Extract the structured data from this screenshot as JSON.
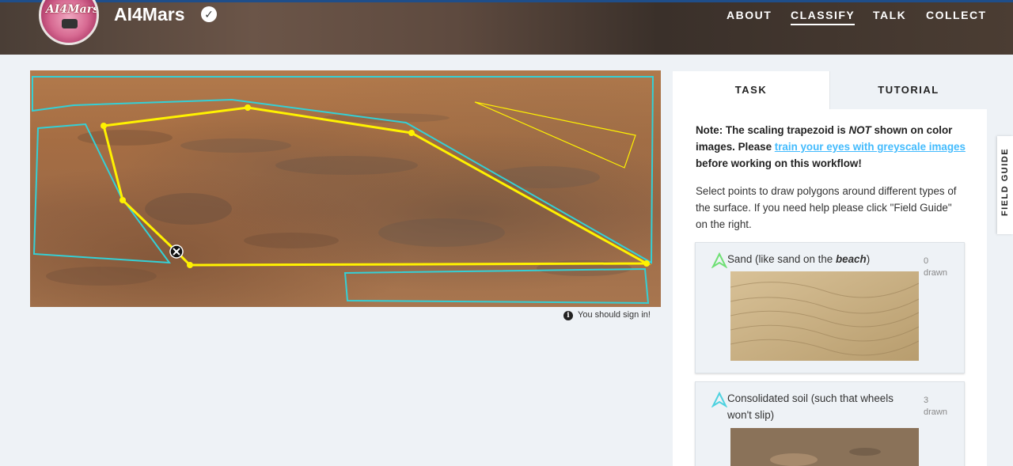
{
  "header": {
    "logo_text": "AI4Mars",
    "title": "AI4Mars",
    "nav": [
      {
        "label": "ABOUT",
        "active": false
      },
      {
        "label": "CLASSIFY",
        "active": true
      },
      {
        "label": "TALK",
        "active": false
      },
      {
        "label": "COLLECT",
        "active": false
      }
    ]
  },
  "canvas": {
    "sign_in_note": "You should sign in!"
  },
  "panel": {
    "tabs": [
      "TASK",
      "TUTORIAL"
    ],
    "note_prefix": "Note: The scaling trapezoid is ",
    "note_emph": "NOT",
    "note_mid": " shown on color images. Please ",
    "note_link": "train your eyes with greyscale images",
    "note_suffix": " before working on this workflow!",
    "instructions": "Select points to draw polygons around different types of the surface. If you need help please click \"Field Guide\" on the right.",
    "choices": [
      {
        "label_pre": "Sand (like sand on the ",
        "label_emph": "beach",
        "label_post": ")",
        "count": "0",
        "drawn": "drawn",
        "color": "#6fdf75"
      },
      {
        "label_pre": "Consolidated soil (such that wheels won't slip)",
        "label_emph": "",
        "label_post": "",
        "count": "3",
        "drawn": "drawn",
        "color": "#4ed2e0"
      }
    ]
  },
  "field_guide": "FIELD GUIDE",
  "colors": {
    "annotation_cyan": "#34d0d6",
    "annotation_yellow": "#fff200",
    "link": "#43bbfd",
    "header_accent": "#1f4e8a"
  }
}
